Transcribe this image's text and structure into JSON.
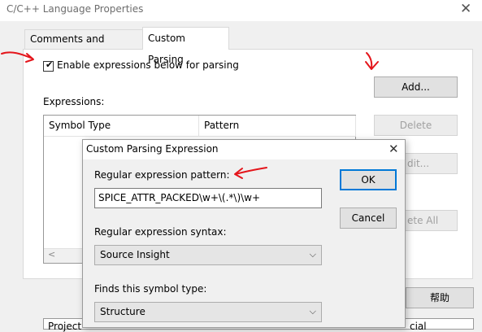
{
  "outer_dialog": {
    "title": "C/C++ Language Properties",
    "close_glyph": "✕",
    "tabs": [
      {
        "label": "Comments and Ranges",
        "selected": false
      },
      {
        "label": "Custom Parsing",
        "selected": true
      }
    ],
    "enable_checkbox": {
      "label": "Enable expressions below for parsing",
      "checked": true
    },
    "expressions_label": "Expressions:",
    "table_headers": [
      "Symbol Type",
      "Pattern"
    ],
    "buttons": {
      "add": "Add...",
      "delete": "Delete",
      "edit_partial": "dit...",
      "delete_all_partial": "ete All",
      "help": "帮助"
    },
    "bottom_partial": {
      "left": "Project",
      "right": "cial"
    },
    "scroll_left_glyph": "<"
  },
  "inner_dialog": {
    "title": "Custom Parsing Expression",
    "close_glyph": "✕",
    "regex_pattern_label": "Regular expression pattern:",
    "regex_pattern_value": "SPICE_ATTR_PACKED\\w+\\(.*\\)\\w+",
    "syntax_label": "Regular expression syntax:",
    "syntax_value": "Source Insight",
    "symbol_type_label": "Finds this symbol type:",
    "symbol_type_value": "Structure",
    "ok": "OK",
    "cancel": "Cancel",
    "chevron_glyph": "⌵"
  },
  "colors": {
    "annotation": "#e4151b",
    "focus_border": "#0078d7",
    "title_text": "#6d6d6d"
  }
}
